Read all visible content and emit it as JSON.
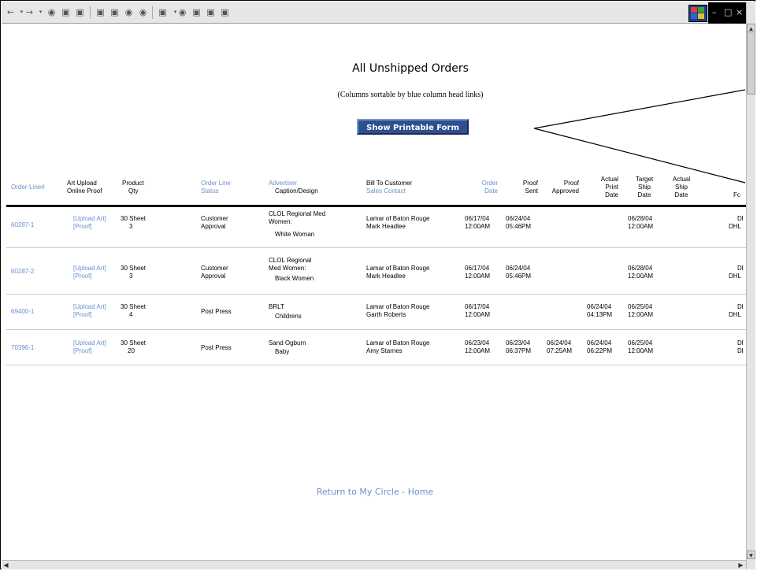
{
  "toolbar": {
    "icons": [
      "back-icon",
      "forward-icon",
      "stop-icon",
      "refresh-icon",
      "home-icon",
      "search-icon",
      "favorites-icon",
      "history-icon",
      "media-icon",
      "mail-icon",
      "print-icon",
      "edit-icon",
      "discuss-icon",
      "messenger-icon"
    ]
  },
  "page": {
    "title": "All Unshipped Orders",
    "subtitle": "(Columns sortable by blue column head links)",
    "print_button": "Show Printable Form",
    "return_link": "Return to My Circle - Home"
  },
  "headers": {
    "order_line": "Order-Line#",
    "art_upload_1": "Art Upload",
    "art_upload_2": "Online Proof",
    "product_1": "Product",
    "product_2": "Qty",
    "status_1": "Order Line",
    "status_2": "Status",
    "advertiser": "Advertiser",
    "caption": "Caption/Design",
    "bill_to": "Bill To Customer",
    "sales_contact": "Sales Contact",
    "order_date_1": "Order",
    "order_date_2": "Date",
    "proof_sent_1": "Proof",
    "proof_sent_2": "Sent",
    "proof_approved_1": "Proof",
    "proof_approved_2": "Approved",
    "actual_print_1": "Actual",
    "actual_print_2": "Print",
    "actual_print_3": "Date",
    "target_ship_1": "Target",
    "target_ship_2": "Ship",
    "target_ship_3": "Date",
    "actual_ship_1": "Actual",
    "actual_ship_2": "Ship",
    "actual_ship_3": "Date",
    "fc": "Fc"
  },
  "rows": [
    {
      "order_line": "60287-1",
      "upload_art": "[Upload Art]",
      "proof": "[Proof]",
      "product": "30 Sheet",
      "qty": "3",
      "status_1": "Customer",
      "status_2": "Approval",
      "advertiser_1": "CLOL Regional Med",
      "advertiser_2": "Women:",
      "advertiser_3": "White Woman",
      "bill_to": "Lamar of Baton Rouge",
      "contact": "Mark Headlee",
      "order_date_1": "06/17/04",
      "order_date_2": "12:00AM",
      "proof_sent_1": "06/24/04",
      "proof_sent_2": "05:46PM",
      "proof_approved_1": "",
      "proof_approved_2": "",
      "print_date_1": "",
      "print_date_2": "",
      "target_1": "06/28/04",
      "target_2": "12:00AM",
      "fc_1": "Dl",
      "fc_2": "DHL"
    },
    {
      "order_line": "60287-2",
      "upload_art": "[Upload Art]",
      "proof": "[Proof]",
      "product": "30 Sheet",
      "qty": "3",
      "status_1": "Customer",
      "status_2": "Approval",
      "advertiser_1": "CLOL Regional",
      "advertiser_2": "Med Women:",
      "advertiser_3": "Black Women",
      "bill_to": "Lamar of Baton Rouge",
      "contact": "Mark Headlee",
      "order_date_1": "06/17/04",
      "order_date_2": "12:00AM",
      "proof_sent_1": "06/24/04",
      "proof_sent_2": "05:46PM",
      "proof_approved_1": "",
      "proof_approved_2": "",
      "print_date_1": "",
      "print_date_2": "",
      "target_1": "06/28/04",
      "target_2": "12:00AM",
      "fc_1": "Dl",
      "fc_2": "DHL"
    },
    {
      "order_line": "69400-1",
      "upload_art": "[Upload Art]",
      "proof": "[Proof]",
      "product": "30 Sheet",
      "qty": "4",
      "status_1": "Post Press",
      "status_2": "",
      "advertiser_1": "BRLT",
      "advertiser_2": "Childrens",
      "advertiser_3": "",
      "bill_to": "Lamar of Baton Rouge",
      "contact": "Garth Roberts",
      "order_date_1": "06/17/04",
      "order_date_2": "12:00AM",
      "proof_sent_1": "",
      "proof_sent_2": "",
      "proof_approved_1": "",
      "proof_approved_2": "",
      "print_date_1": "06/24/04",
      "print_date_2": "04:13PM",
      "target_1": "06/25/04",
      "target_2": "12:00AM",
      "fc_1": "Dl",
      "fc_2": "DHL"
    },
    {
      "order_line": "70396-1",
      "upload_art": "[Upload Art]",
      "proof": "[Proof]",
      "product": "30 Sheet",
      "qty": "20",
      "status_1": "Post Press",
      "status_2": "",
      "advertiser_1": "Sand Ogburn",
      "advertiser_2": "Baby",
      "advertiser_3": "",
      "bill_to": "Lamar of Baton Rouge",
      "contact": "Amy Starnes",
      "order_date_1": "06/23/04",
      "order_date_2": "12:00AM",
      "proof_sent_1": "06/23/04",
      "proof_sent_2": "06:37PM",
      "proof_approved_1": "06/24/04",
      "proof_approved_2": "07:25AM",
      "print_date_1": "06/24/04",
      "print_date_2": "06:22PM",
      "target_1": "06/25/04",
      "target_2": "12:00AM",
      "fc_1": "Dl",
      "fc_2": "Dl"
    }
  ],
  "colors": {
    "link": "#6b8fcf",
    "button": "#2f4f8f"
  }
}
